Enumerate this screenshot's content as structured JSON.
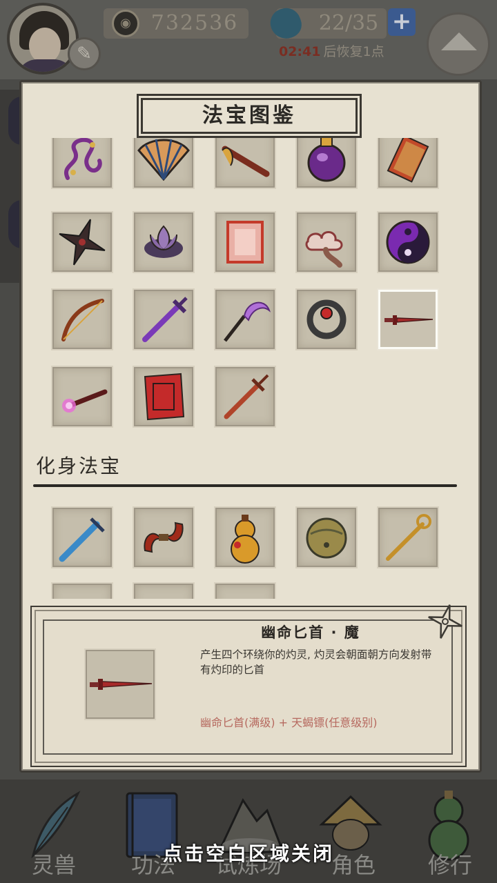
{
  "header": {
    "coins": "732536",
    "energy": "22/35",
    "plus_label": "+",
    "recover_timer": "02:41",
    "recover_text": "后恢复1点"
  },
  "panel": {
    "title": "法宝图鉴",
    "section_label": "化身法宝"
  },
  "treasures": [
    {
      "icon": "purple-ribbon-icon"
    },
    {
      "icon": "folding-fan-icon"
    },
    {
      "icon": "flute-icon"
    },
    {
      "icon": "gourd-bottle-icon"
    },
    {
      "icon": "talisman-icon"
    },
    {
      "icon": "shuriken-icon"
    },
    {
      "icon": "lotus-icon"
    },
    {
      "icon": "scroll-paper-icon"
    },
    {
      "icon": "cloud-ruyi-icon"
    },
    {
      "icon": "yin-yang-icon"
    },
    {
      "icon": "bow-icon"
    },
    {
      "icon": "purple-sword-icon"
    },
    {
      "icon": "sickle-icon"
    },
    {
      "icon": "ring-icon"
    },
    {
      "icon": "dagger-icon",
      "selected": true
    },
    {
      "icon": "torch-icon"
    },
    {
      "icon": "red-scroll-icon"
    },
    {
      "icon": "red-sword-icon"
    }
  ],
  "avatar_treasures": [
    {
      "icon": "blue-sword-icon"
    },
    {
      "icon": "twin-blade-icon"
    },
    {
      "icon": "golden-gourd-icon"
    },
    {
      "icon": "bell-icon"
    },
    {
      "icon": "golden-staff-icon"
    }
  ],
  "detail": {
    "name": "幽命匕首 · 魔",
    "description": "产生四个环绕你的灼灵, 灼灵会朝面朝方向发射带有灼印的匕首",
    "recipe": "幽命匕首(满级)  +  天蝎镖(任意级别)",
    "icon": "dagger-icon"
  },
  "bottom_nav": [
    {
      "label": "灵兽",
      "icon": "feather-icon"
    },
    {
      "label": "功法",
      "icon": "book-icon"
    },
    {
      "label": "试炼场",
      "icon": "mountain-icon"
    },
    {
      "label": "角色",
      "icon": "straw-hat-icon"
    },
    {
      "label": "修行",
      "icon": "gourd-icon"
    }
  ],
  "close_hint": "点击空白区域关闭",
  "colors": {
    "panel_bg": "#e7e1d1",
    "slot_bg": "#c5beac",
    "recipe_text": "#b6695f",
    "timer_text": "#7a2d22",
    "overlay_dim": "#4a4a47"
  }
}
